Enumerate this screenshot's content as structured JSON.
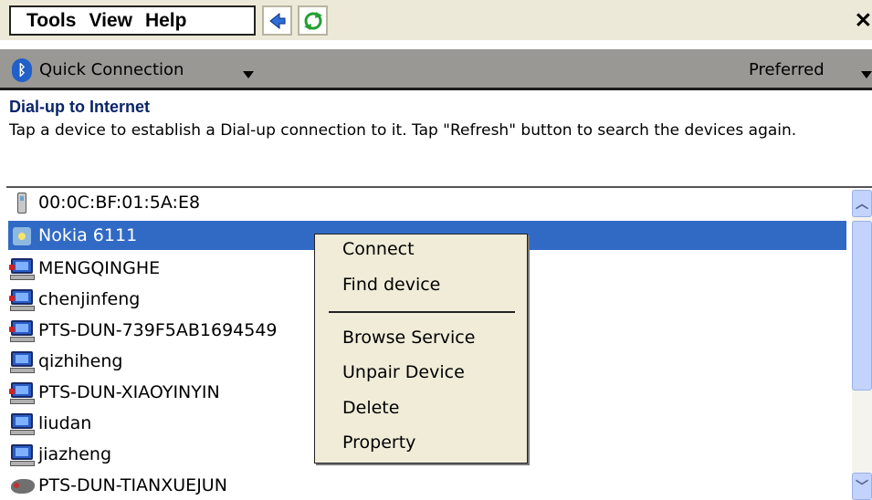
{
  "menubar": {
    "items": [
      "Tools",
      "View",
      "Help"
    ],
    "back_icon": "back-arrow-icon",
    "refresh_icon": "refresh-icon",
    "close_label": "✕"
  },
  "quickbar": {
    "icon": "bluetooth-icon",
    "label": "Quick Connection",
    "right_label": "Preferred"
  },
  "header": {
    "title": "Dial-up to Internet",
    "description": "Tap a device to establish a Dial-up connection to it. Tap \"Refresh\" button to search the devices again."
  },
  "devices": [
    {
      "name": "00:0C:BF:01:5A:E8",
      "icon": "phone-icon"
    },
    {
      "name": "Nokia 6111",
      "icon": "device-icon",
      "selected": true
    },
    {
      "name": "MENGQINGHE",
      "icon": "computer-icon"
    },
    {
      "name": "chenjinfeng",
      "icon": "computer-icon"
    },
    {
      "name": "PTS-DUN-739F5AB1694549",
      "icon": "computer-icon"
    },
    {
      "name": "qizhiheng",
      "icon": "computer-icon"
    },
    {
      "name": "PTS-DUN-XIAOYINYIN",
      "icon": "computer-icon"
    },
    {
      "name": "liudan",
      "icon": "computer-icon"
    },
    {
      "name": "jiazheng",
      "icon": "computer-icon"
    },
    {
      "name": "PTS-DUN-TIANXUEJUN",
      "icon": "bird-icon"
    }
  ],
  "context_menu": {
    "items": [
      "Connect",
      "Find device",
      "Browse Service",
      "Unpair Device",
      "Delete",
      "Property"
    ]
  },
  "colors": {
    "selection": "#316ac5",
    "heading": "#0a246a",
    "menu_bg": "#f0ecd8"
  }
}
